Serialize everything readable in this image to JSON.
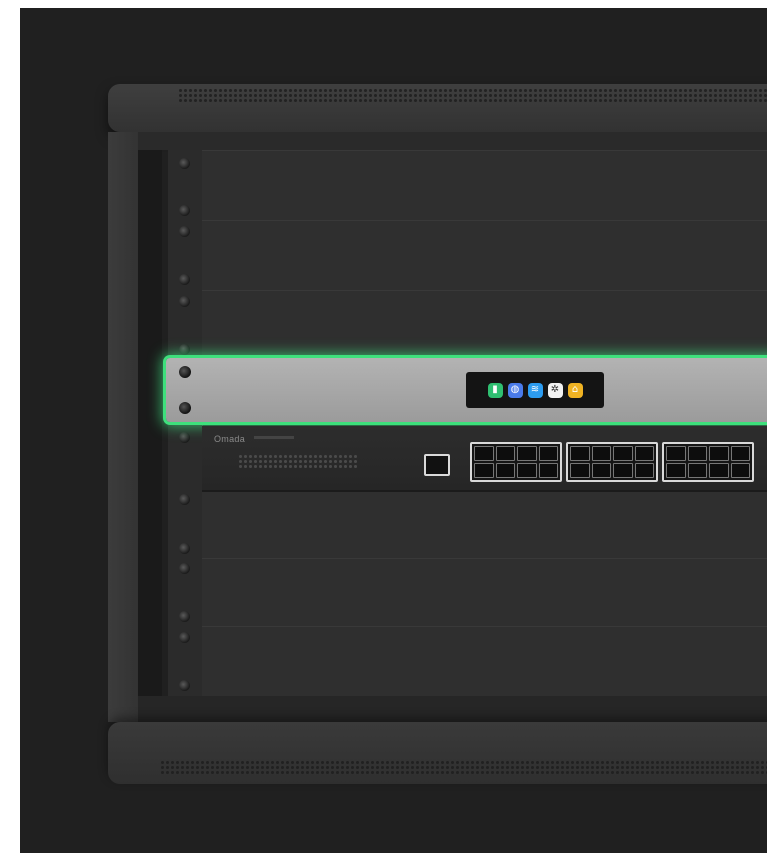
{
  "scene": {
    "description_hidden": "",
    "brand": "Omada",
    "screen_apps": [
      {
        "name": "statistics-app-icon",
        "glyph": "▮",
        "color": "#2fbf71"
      },
      {
        "name": "internet-globe-app-icon",
        "glyph": "◍",
        "color": "#4a7bea"
      },
      {
        "name": "wifi-app-icon",
        "glyph": "≋",
        "color": "#2c9cf0"
      },
      {
        "name": "settings-gear-app-icon",
        "glyph": "✲",
        "color": "#f2f2f2"
      },
      {
        "name": "home-app-icon",
        "glyph": "⌂",
        "color": "#f0b323"
      }
    ],
    "colors": {
      "background": "#202020",
      "highlight_glow": "#3ee07c",
      "panel": "#2f2f2f"
    }
  }
}
